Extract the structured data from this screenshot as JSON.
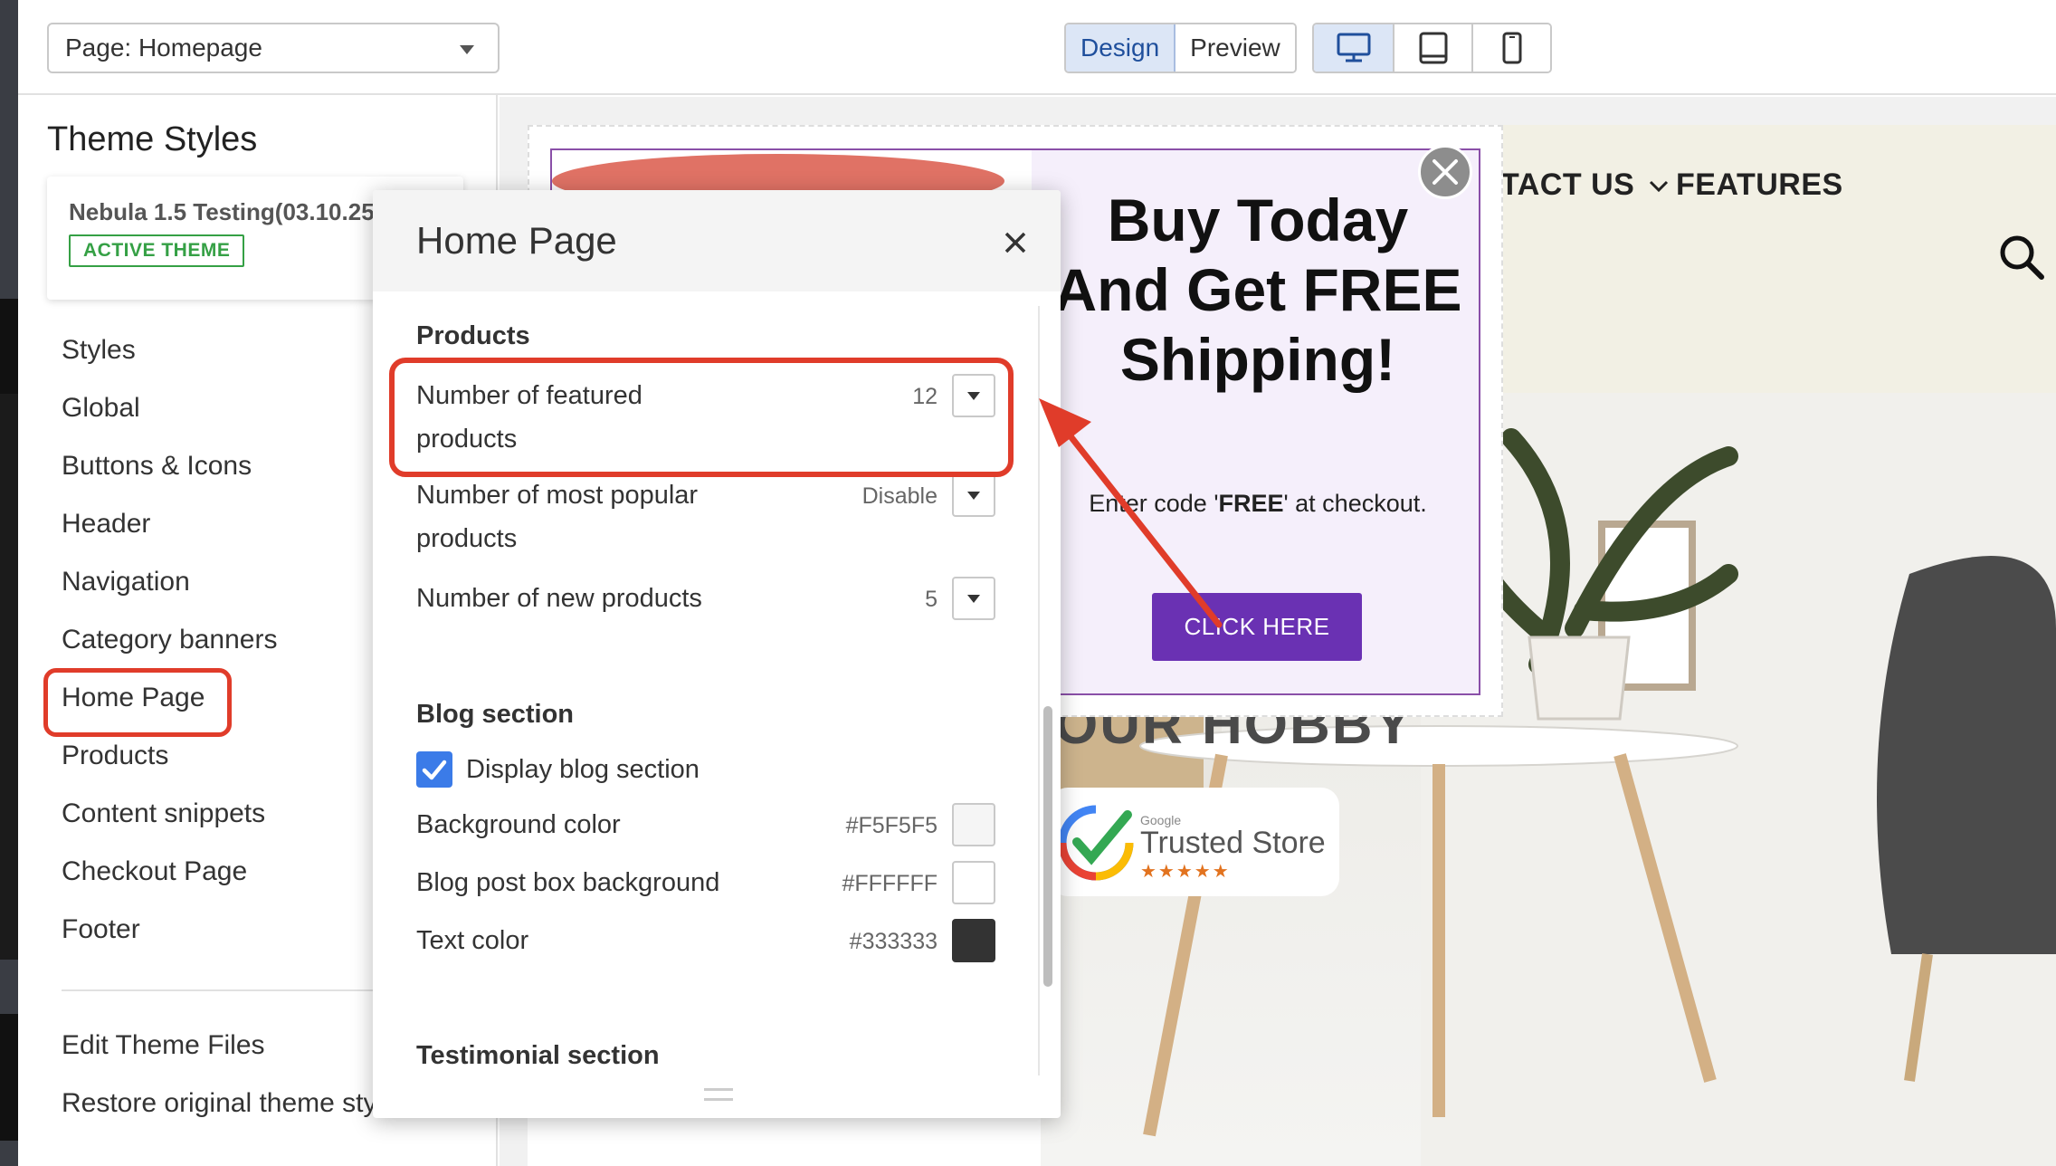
{
  "toolbar": {
    "page_select_value": "Page: Homepage",
    "mode_design": "Design",
    "mode_preview": "Preview",
    "devices": [
      "desktop-icon",
      "tablet-icon",
      "mobile-icon"
    ],
    "active_device": "desktop"
  },
  "sidebar": {
    "title": "Theme Styles",
    "theme_name": "Nebula 1.5 Testing(03.10.25)",
    "theme_badge": "ACTIVE THEME",
    "items": [
      {
        "label": "Styles"
      },
      {
        "label": "Global"
      },
      {
        "label": "Buttons & Icons"
      },
      {
        "label": "Header"
      },
      {
        "label": "Navigation"
      },
      {
        "label": "Category banners"
      },
      {
        "label": "Home Page"
      },
      {
        "label": "Products"
      },
      {
        "label": "Content snippets"
      },
      {
        "label": "Checkout Page"
      },
      {
        "label": "Footer"
      }
    ],
    "footer_items": [
      {
        "label": "Edit Theme Files"
      },
      {
        "label": "Restore original theme sty"
      }
    ]
  },
  "panel": {
    "title": "Home Page",
    "products_section": {
      "title": "Products",
      "rows": [
        {
          "label_line1": "Number of featured",
          "label_line2": "products",
          "value": "12"
        },
        {
          "label_line1": "Number of most popular",
          "label_line2": "products",
          "value": "Disable"
        },
        {
          "label_line1": "Number of new products",
          "label_line2": "",
          "value": "5"
        }
      ]
    },
    "blog_section": {
      "title": "Blog section",
      "checkbox_label": "Display blog section",
      "checkbox_checked": true,
      "colors": [
        {
          "label": "Background color",
          "value": "#F5F5F5"
        },
        {
          "label": "Blog post box background",
          "value": "#FFFFFF"
        },
        {
          "label": "Text color",
          "value": "#333333"
        }
      ]
    },
    "testimonial_section": {
      "title": "Testimonial section"
    }
  },
  "site": {
    "nav_links": [
      "TACT US",
      "FEATURES"
    ],
    "hero_text": "OUR HOBBY",
    "trusted_brand": "Google",
    "trusted_label": "Trusted Store",
    "trusted_stars": "★★★★★"
  },
  "popup": {
    "headline": "Buy Today And Get FREE Shipping!",
    "sub_pre": "Enter code '",
    "sub_code": "FREE",
    "sub_post": "' at checkout.",
    "cta": "CLICK HERE"
  },
  "colors": {
    "accent_red": "#e03c2a",
    "popup_purple": "#6a31b3",
    "active_blue": "#dce6f6",
    "success_green": "#35a045"
  }
}
